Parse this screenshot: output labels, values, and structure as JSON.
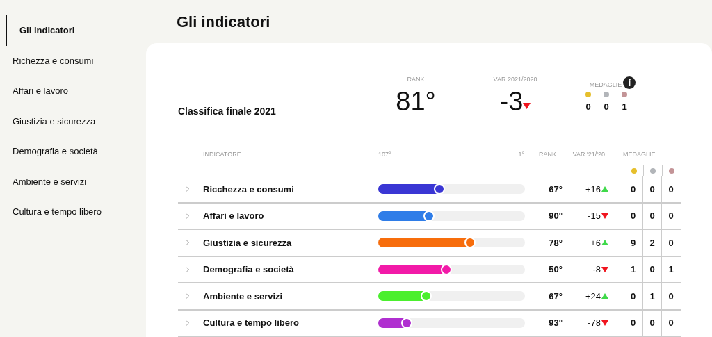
{
  "sidebar": {
    "items": [
      {
        "label": "Gli indicatori",
        "selected": true
      },
      {
        "label": "Richezza e consumi",
        "selected": false
      },
      {
        "label": "Affari e lavoro",
        "selected": false
      },
      {
        "label": "Giustizia e sicurezza",
        "selected": false
      },
      {
        "label": "Demografia e società",
        "selected": false
      },
      {
        "label": "Ambiente e servizi",
        "selected": false
      },
      {
        "label": "Cultura e tempo libero",
        "selected": false
      }
    ]
  },
  "page_title": "Gli indicatori",
  "summary": {
    "title": "Classifica finale 2021",
    "rank_label": "RANK",
    "rank": "81°",
    "var_label": "VAR.2021/2020",
    "var": "-3",
    "rising": false,
    "medals_label": "MEDAGLIE",
    "medals": [
      {
        "color": "#e6bf2c",
        "count": "0"
      },
      {
        "color": "#b2b5b9",
        "count": "0"
      },
      {
        "color": "#c39497",
        "count": "1"
      }
    ]
  },
  "table": {
    "columns": {
      "indicator": "INDICATORE",
      "scale_min": "107°",
      "scale_max": "1°",
      "rank": "RANK",
      "var": "VAR.'21/'20",
      "medals": "MEDAGLIE"
    },
    "medal_colors": [
      {
        "color": "#e6bf2c"
      },
      {
        "color": "#b2b5b9"
      },
      {
        "color": "#c39497"
      }
    ],
    "rows": [
      {
        "name": "Ricchezza e consumi",
        "color": "#3a36d4",
        "level": 0.42,
        "rank": "67°",
        "var": "+16",
        "rising": true,
        "medals": [
          "0",
          "0",
          "0"
        ]
      },
      {
        "name": "Affari e lavoro",
        "color": "#2f7de8",
        "level": 0.35,
        "rank": "90°",
        "var": "-15",
        "rising": false,
        "medals": [
          "0",
          "0",
          "0"
        ]
      },
      {
        "name": "Giustizia e sicurezza",
        "color": "#f76d0c",
        "level": 0.63,
        "rank": "78°",
        "var": "+6",
        "rising": true,
        "medals": [
          "9",
          "2",
          "0"
        ]
      },
      {
        "name": "Demografia e società",
        "color": "#f21aa8",
        "level": 0.47,
        "rank": "50°",
        "var": "-8",
        "rising": false,
        "medals": [
          "1",
          "0",
          "1"
        ]
      },
      {
        "name": "Ambiente e servizi",
        "color": "#4bef2e",
        "level": 0.33,
        "rank": "67°",
        "var": "+24",
        "rising": true,
        "medals": [
          "0",
          "1",
          "0"
        ]
      },
      {
        "name": "Cultura e tempo libero",
        "color": "#b02fd0",
        "level": 0.2,
        "rank": "93°",
        "var": "-78",
        "rising": false,
        "medals": [
          "0",
          "0",
          "0"
        ]
      }
    ]
  }
}
